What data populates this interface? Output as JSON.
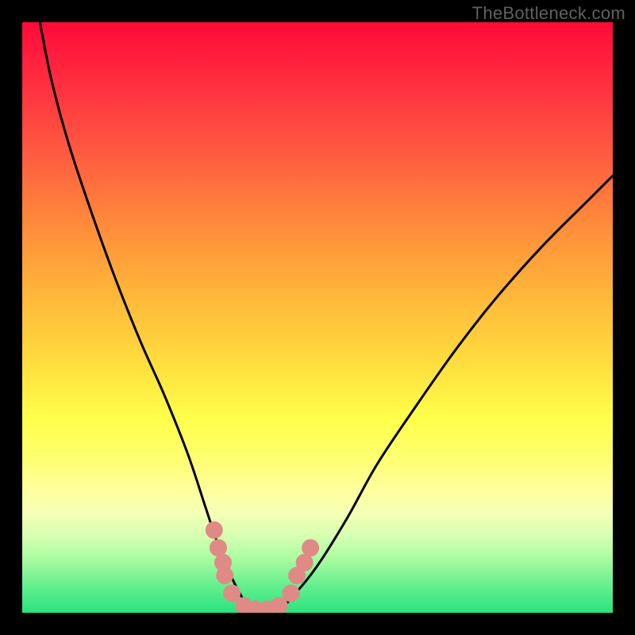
{
  "watermark": "TheBottleneck.com",
  "chart_data": {
    "type": "line",
    "title": "",
    "xlabel": "",
    "ylabel": "",
    "xlim": [
      0,
      100
    ],
    "ylim": [
      0,
      100
    ],
    "series": [
      {
        "name": "bottleneck-curve",
        "x": [
          3,
          5,
          8,
          12,
          16,
          20,
          24,
          28,
          31,
          33,
          35,
          37,
          39,
          41,
          43,
          46,
          50,
          55,
          60,
          66,
          73,
          80,
          88,
          96,
          100
        ],
        "values": [
          100,
          90,
          79,
          67,
          56,
          46,
          37,
          27,
          18,
          12,
          7,
          3,
          0,
          0,
          0,
          3,
          8,
          16,
          25,
          34,
          44,
          53,
          62,
          70,
          74
        ]
      }
    ],
    "markers": {
      "name": "highlight-dots",
      "color": "#e08a85",
      "points": [
        {
          "x": 32.5,
          "y": 14
        },
        {
          "x": 33.2,
          "y": 11
        },
        {
          "x": 34.0,
          "y": 8.5
        },
        {
          "x": 34.3,
          "y": 6.3
        },
        {
          "x": 35.5,
          "y": 3.3
        },
        {
          "x": 37.5,
          "y": 1.2
        },
        {
          "x": 39.5,
          "y": 0.6
        },
        {
          "x": 41.5,
          "y": 0.6
        },
        {
          "x": 43.5,
          "y": 1.2
        },
        {
          "x": 45.5,
          "y": 3.3
        },
        {
          "x": 46.5,
          "y": 6.3
        },
        {
          "x": 47.8,
          "y": 8.5
        },
        {
          "x": 48.8,
          "y": 11
        }
      ]
    }
  }
}
